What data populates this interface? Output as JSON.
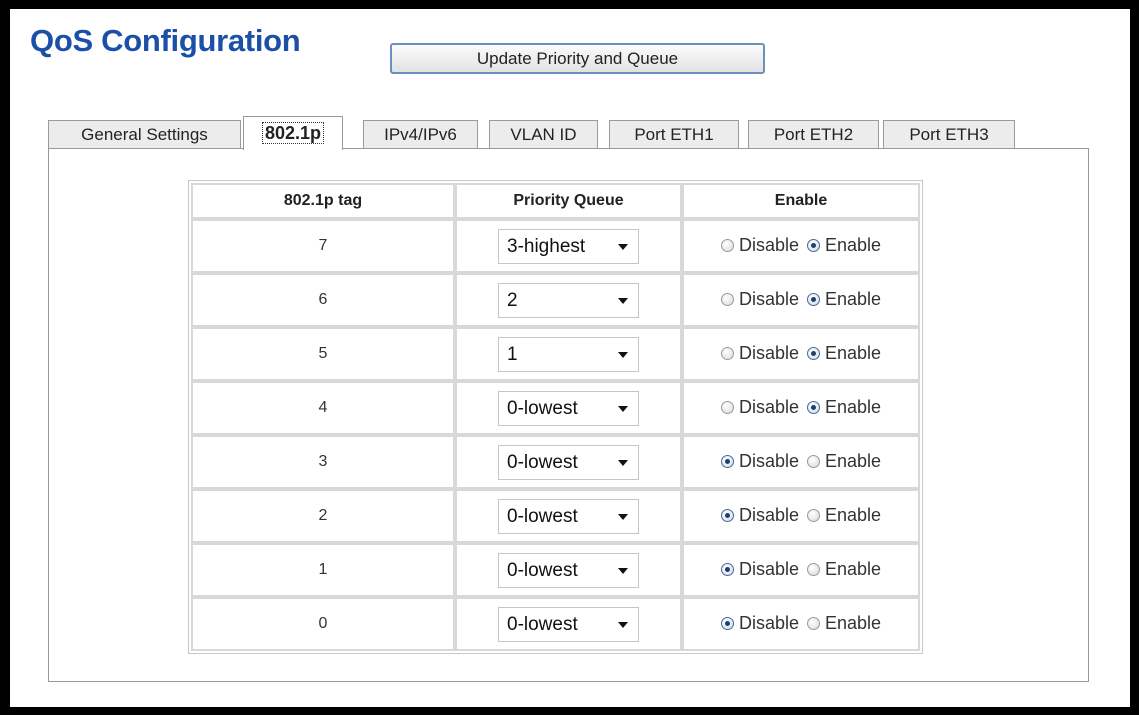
{
  "page": {
    "title": "QoS Configuration",
    "update_button": "Update Priority and Queue"
  },
  "tabs": [
    {
      "label": "General Settings",
      "active": false
    },
    {
      "label": "802.1p",
      "active": true
    },
    {
      "label": "IPv4/IPv6",
      "active": false
    },
    {
      "label": "VLAN ID",
      "active": false
    },
    {
      "label": "Port ETH1",
      "active": false
    },
    {
      "label": "Port ETH2",
      "active": false
    },
    {
      "label": "Port ETH3",
      "active": false
    }
  ],
  "table": {
    "headers": [
      "802.1p tag",
      "Priority Queue",
      "Enable"
    ],
    "disable_label": "Disable",
    "enable_label": "Enable",
    "rows": [
      {
        "tag": "7",
        "queue": "3-highest",
        "enabled": true
      },
      {
        "tag": "6",
        "queue": "2",
        "enabled": true
      },
      {
        "tag": "5",
        "queue": "1",
        "enabled": true
      },
      {
        "tag": "4",
        "queue": "0-lowest",
        "enabled": true
      },
      {
        "tag": "3",
        "queue": "0-lowest",
        "enabled": false
      },
      {
        "tag": "2",
        "queue": "0-lowest",
        "enabled": false
      },
      {
        "tag": "1",
        "queue": "0-lowest",
        "enabled": false
      },
      {
        "tag": "0",
        "queue": "0-lowest",
        "enabled": false
      }
    ]
  },
  "colors": {
    "title": "#1b4fa8",
    "button_border": "#6b8fc0"
  }
}
